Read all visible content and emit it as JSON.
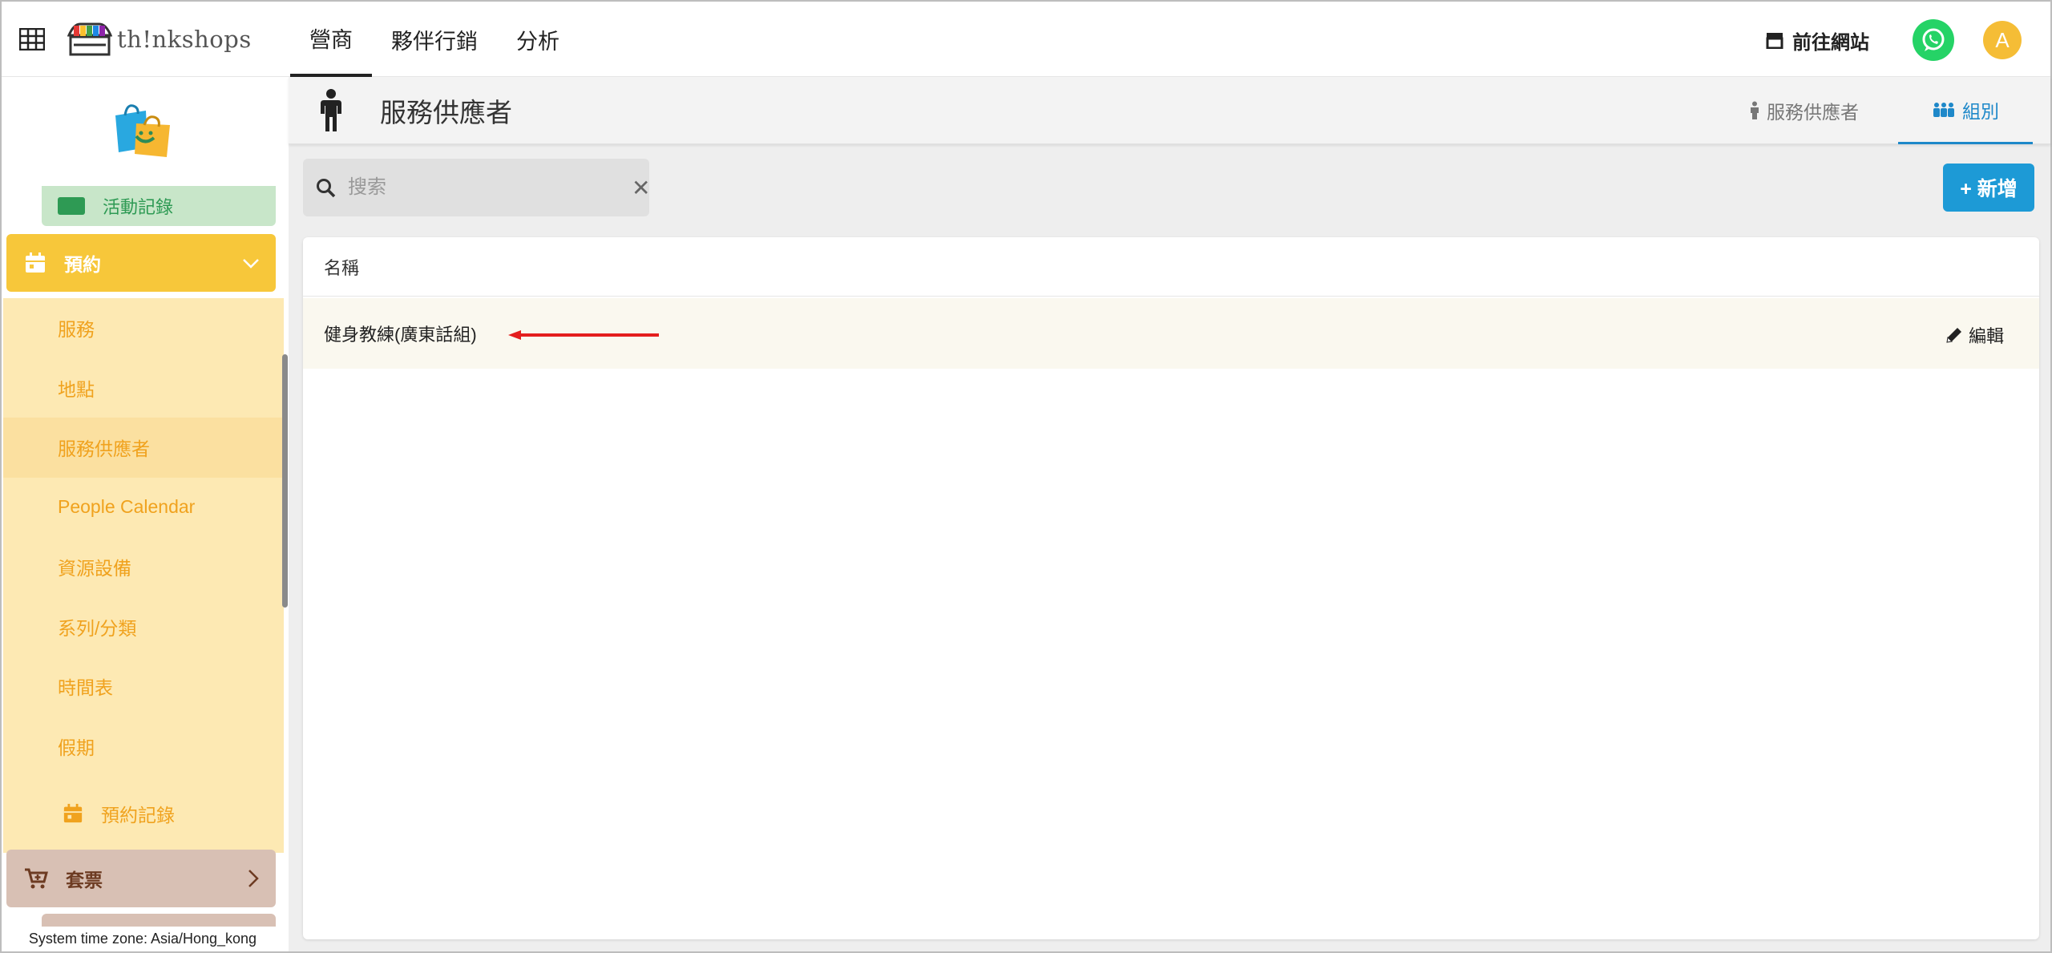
{
  "app": {
    "logo_text": "th!nkshops",
    "nav": [
      {
        "label": "營商",
        "active": true
      },
      {
        "label": "夥伴行銷",
        "active": false
      },
      {
        "label": "分析",
        "active": false
      }
    ],
    "goto_site": "前往網站",
    "avatar_initial": "A"
  },
  "sidebar": {
    "activity_log": "活動記錄",
    "booking": {
      "label": "預約",
      "items": [
        {
          "label": "服務",
          "active": false
        },
        {
          "label": "地點",
          "active": false
        },
        {
          "label": "服務供應者",
          "active": true
        },
        {
          "label": "People Calendar",
          "active": false
        },
        {
          "label": "資源設備",
          "active": false
        },
        {
          "label": "系列/分類",
          "active": false
        },
        {
          "label": "時間表",
          "active": false
        },
        {
          "label": "假期",
          "active": false
        }
      ]
    },
    "booking_records": "預約記錄",
    "tickets": "套票",
    "timezone": "System time zone: Asia/Hong_kong"
  },
  "page": {
    "title": "服務供應者",
    "tabs": [
      {
        "label": "服務供應者",
        "icon": "person-icon",
        "active": false
      },
      {
        "label": "組別",
        "icon": "group-icon",
        "active": true
      }
    ],
    "search": {
      "placeholder": "搜索",
      "value": ""
    },
    "add_button": "+ 新增",
    "table": {
      "column_name": "名稱",
      "rows": [
        {
          "name": "健身教練(廣東話組)",
          "action": "編輯"
        }
      ]
    }
  },
  "colors": {
    "accent_blue": "#1d9ad6",
    "yellow": "#f7c73a",
    "yellow_light": "#fde9b3",
    "green_light": "#c8e6c9",
    "brown_light": "#d8c0b4",
    "whatsapp": "#25d366",
    "arrow_red": "#e41e1e"
  }
}
